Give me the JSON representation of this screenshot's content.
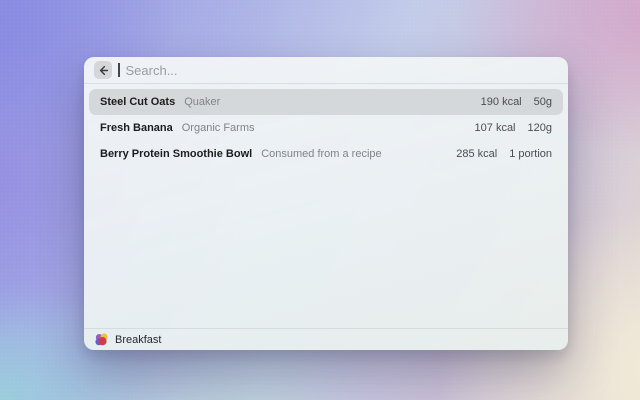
{
  "desktop": {
    "wallpaper_colors": {
      "top_left": "#8f91e1",
      "top_right": "#d2a4c9",
      "bottom_left": "#9ed7da",
      "bottom_right": "#f2ecda",
      "center": "#c3cfe9"
    }
  },
  "window": {
    "search_bar": {
      "back_icon": "arrow-left",
      "placeholder": "Search...",
      "value": ""
    },
    "results": [
      {
        "name": "Steel Cut Oats",
        "brand": "Quaker",
        "calories": "190 kcal",
        "amount": "50g",
        "selected": true
      },
      {
        "name": "Fresh Banana",
        "brand": "Organic Farms",
        "calories": "107 kcal",
        "amount": "120g",
        "selected": false
      },
      {
        "name": "Berry Protein Smoothie Bowl",
        "brand": "Consumed from a recipe",
        "calories": "285 kcal",
        "amount": "1 portion",
        "selected": false
      }
    ],
    "footer": {
      "icon": "food-app",
      "label": "Breakfast"
    },
    "colors": {
      "selected_row_bg": "#d5d8da",
      "primary_text": "#1c1c1e",
      "secondary_text": "#83838a",
      "metric_text": "#4c4c52",
      "app_icon_red": "#d23b4e",
      "app_icon_yellow": "#eebf3a",
      "app_icon_blue": "#5566d8",
      "app_icon_purple": "#9a5fb8"
    }
  }
}
